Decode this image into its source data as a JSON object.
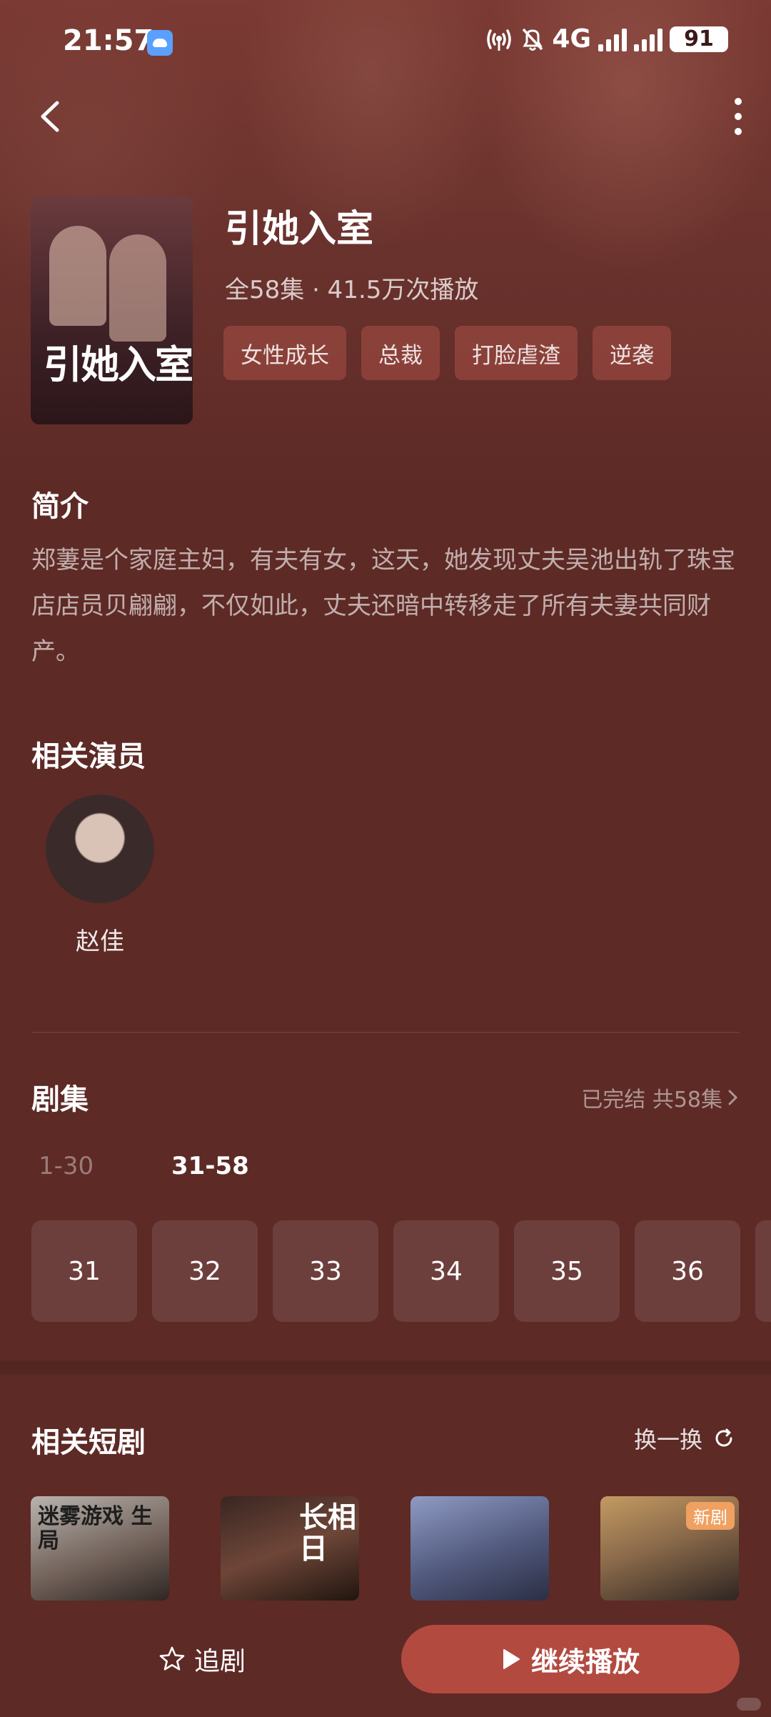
{
  "status_bar": {
    "time": "21:57",
    "network": "4G",
    "battery": "91"
  },
  "drama": {
    "title": "引她入室",
    "meta": "全58集 · 41.5万次播放",
    "poster_title": "引她入室",
    "tags": [
      "女性成长",
      "总裁",
      "打脸虐渣",
      "逆袭"
    ]
  },
  "intro": {
    "heading": "简介",
    "text": "郑萋是个家庭主妇，有夫有女，这天，她发现丈夫吴池出轨了珠宝店店员贝翩翩，不仅如此，丈夫还暗中转移走了所有夫妻共同财产。"
  },
  "actors": {
    "heading": "相关演员",
    "items": [
      {
        "name": "赵佳"
      }
    ]
  },
  "episodes": {
    "heading": "剧集",
    "status": "已完结 共58集",
    "ranges": [
      "1-30",
      "31-58"
    ],
    "items": [
      "31",
      "32",
      "33",
      "34",
      "35",
      "36"
    ]
  },
  "related": {
    "heading": "相关短剧",
    "refresh_label": "换一换",
    "cards": [
      {
        "title": "迷雾游戏 生局"
      },
      {
        "title": "长相日"
      },
      {
        "title": ""
      },
      {
        "title": "",
        "badge": "新剧"
      }
    ]
  },
  "bottom_bar": {
    "follow_label": "追剧",
    "play_label": "继续播放"
  },
  "colors": {
    "background": "#5d2a26",
    "accent": "#b24a40",
    "tag_bg": "#8f463e"
  }
}
